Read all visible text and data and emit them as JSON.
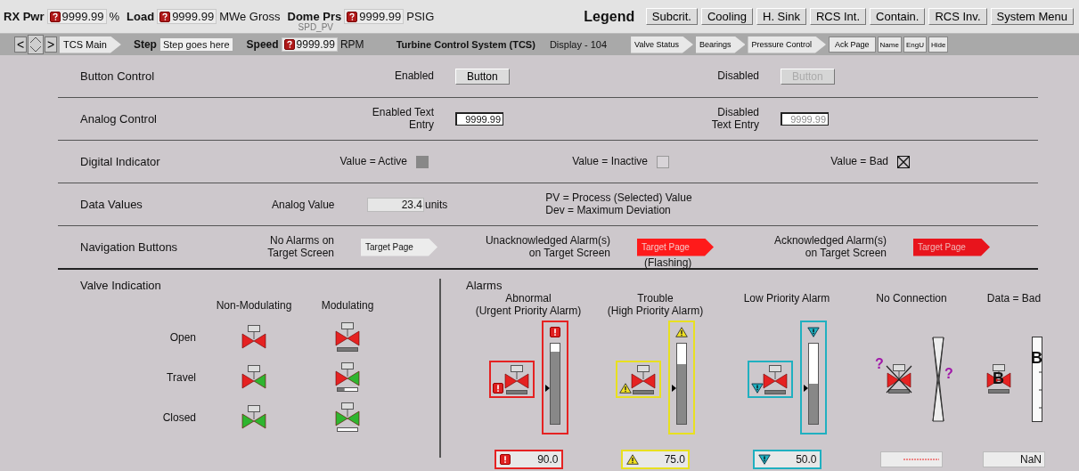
{
  "header": {
    "readouts": [
      {
        "label": "RX Pwr",
        "value": "9999.99",
        "unit": "%"
      },
      {
        "label": "Load",
        "value": "9999.99",
        "unit": "MWe Gross"
      },
      {
        "label": "Dome Prs",
        "value": "9999.99",
        "unit": "PSIG"
      }
    ],
    "title": "Legend",
    "buttons": [
      "Subcrit.",
      "Cooling",
      "H. Sink",
      "RCS Int.",
      "Contain.",
      "RCS Inv.",
      "System Menu"
    ]
  },
  "nav_bar": {
    "prev": "<",
    "next": ">",
    "home": "TCS Main",
    "step_label": "Step",
    "step_value": "Step goes here",
    "speed": {
      "tag": "SPD_PV",
      "label": "Speed",
      "value": "9999.99",
      "unit": "RPM"
    },
    "system": "Turbine Control System (TCS)",
    "display": "Display - 104",
    "tabs": [
      "Valve Status",
      "Bearings",
      "Pressure Control"
    ],
    "buttons": [
      "Ack Page",
      "Name",
      "EngU",
      "Hide"
    ]
  },
  "legend_rows": [
    {
      "kind": "buttons",
      "label": "Button Control",
      "items": [
        {
          "lines": [
            "Enabled"
          ],
          "button": "Button",
          "disabled": false
        },
        {
          "lines": [
            "Disabled"
          ],
          "button": "Button",
          "disabled": true
        }
      ]
    },
    {
      "kind": "entries",
      "label": "Analog Control",
      "items": [
        {
          "lines": [
            "Enabled Text",
            "Entry"
          ],
          "value": "9999.99",
          "disabled": false
        },
        {
          "lines": [
            "Disabled",
            "Text Entry"
          ],
          "value": "9999.99",
          "disabled": true
        }
      ]
    },
    {
      "kind": "indicators",
      "label": "Digital Indicator",
      "items": [
        {
          "label": "Value = Active",
          "kind": "active"
        },
        {
          "label": "Value = Inactive",
          "kind": "inactive"
        },
        {
          "label": "Value = Bad",
          "kind": "bad"
        }
      ]
    },
    {
      "kind": "values",
      "label": "Data Values",
      "value_label": "Analog Value",
      "value": "23.4",
      "unit": "units",
      "notes": [
        "PV = Process (Selected) Value",
        "Dev = Maximum Deviation"
      ]
    },
    {
      "kind": "navigation",
      "label": "Navigation Buttons",
      "items": [
        {
          "lines": [
            "No Alarms on",
            "Target Screen"
          ],
          "button": "Target Page",
          "kind": "no_alarm"
        },
        {
          "lines": [
            "Unacknowledged Alarm(s)",
            "on Target Screen"
          ],
          "button": "Target Page",
          "kind": "unacknowledged",
          "note": "(Flashing)"
        },
        {
          "lines": [
            "Acknowledged Alarm(s)",
            "on Target Screen"
          ],
          "button": "Target Page",
          "kind": "acknowledged"
        }
      ]
    }
  ],
  "valve_indication": {
    "title": "Valve Indication",
    "columns": [
      "Non-Modulating",
      "Modulating"
    ],
    "rows": [
      {
        "label": "Open",
        "kind": "open"
      },
      {
        "label": "Travel",
        "kind": "travel"
      },
      {
        "label": "Closed",
        "kind": "closed"
      }
    ]
  },
  "alarms": {
    "title": "Alarms",
    "columns": [
      {
        "kind": "urgent",
        "lines": [
          "Abnormal",
          "(Urgent Priority Alarm)"
        ],
        "color": "#e52222",
        "level": 0.9,
        "value": "90.0"
      },
      {
        "kind": "high",
        "lines": [
          "Trouble",
          "(High Priority Alarm)"
        ],
        "color": "#e8e020",
        "level": 0.75,
        "value": "75.0"
      },
      {
        "kind": "low",
        "lines": [
          "Low Priority Alarm"
        ],
        "color": "#20b0c0",
        "level": 0.5,
        "value": "50.0"
      },
      {
        "kind": "no_connection",
        "lines": [
          "No Connection"
        ],
        "marks": [
          "?",
          "?"
        ]
      },
      {
        "kind": "bad",
        "lines": [
          "Data = Bad"
        ],
        "marks": [
          "B",
          "B"
        ],
        "value": "NaN"
      }
    ]
  }
}
